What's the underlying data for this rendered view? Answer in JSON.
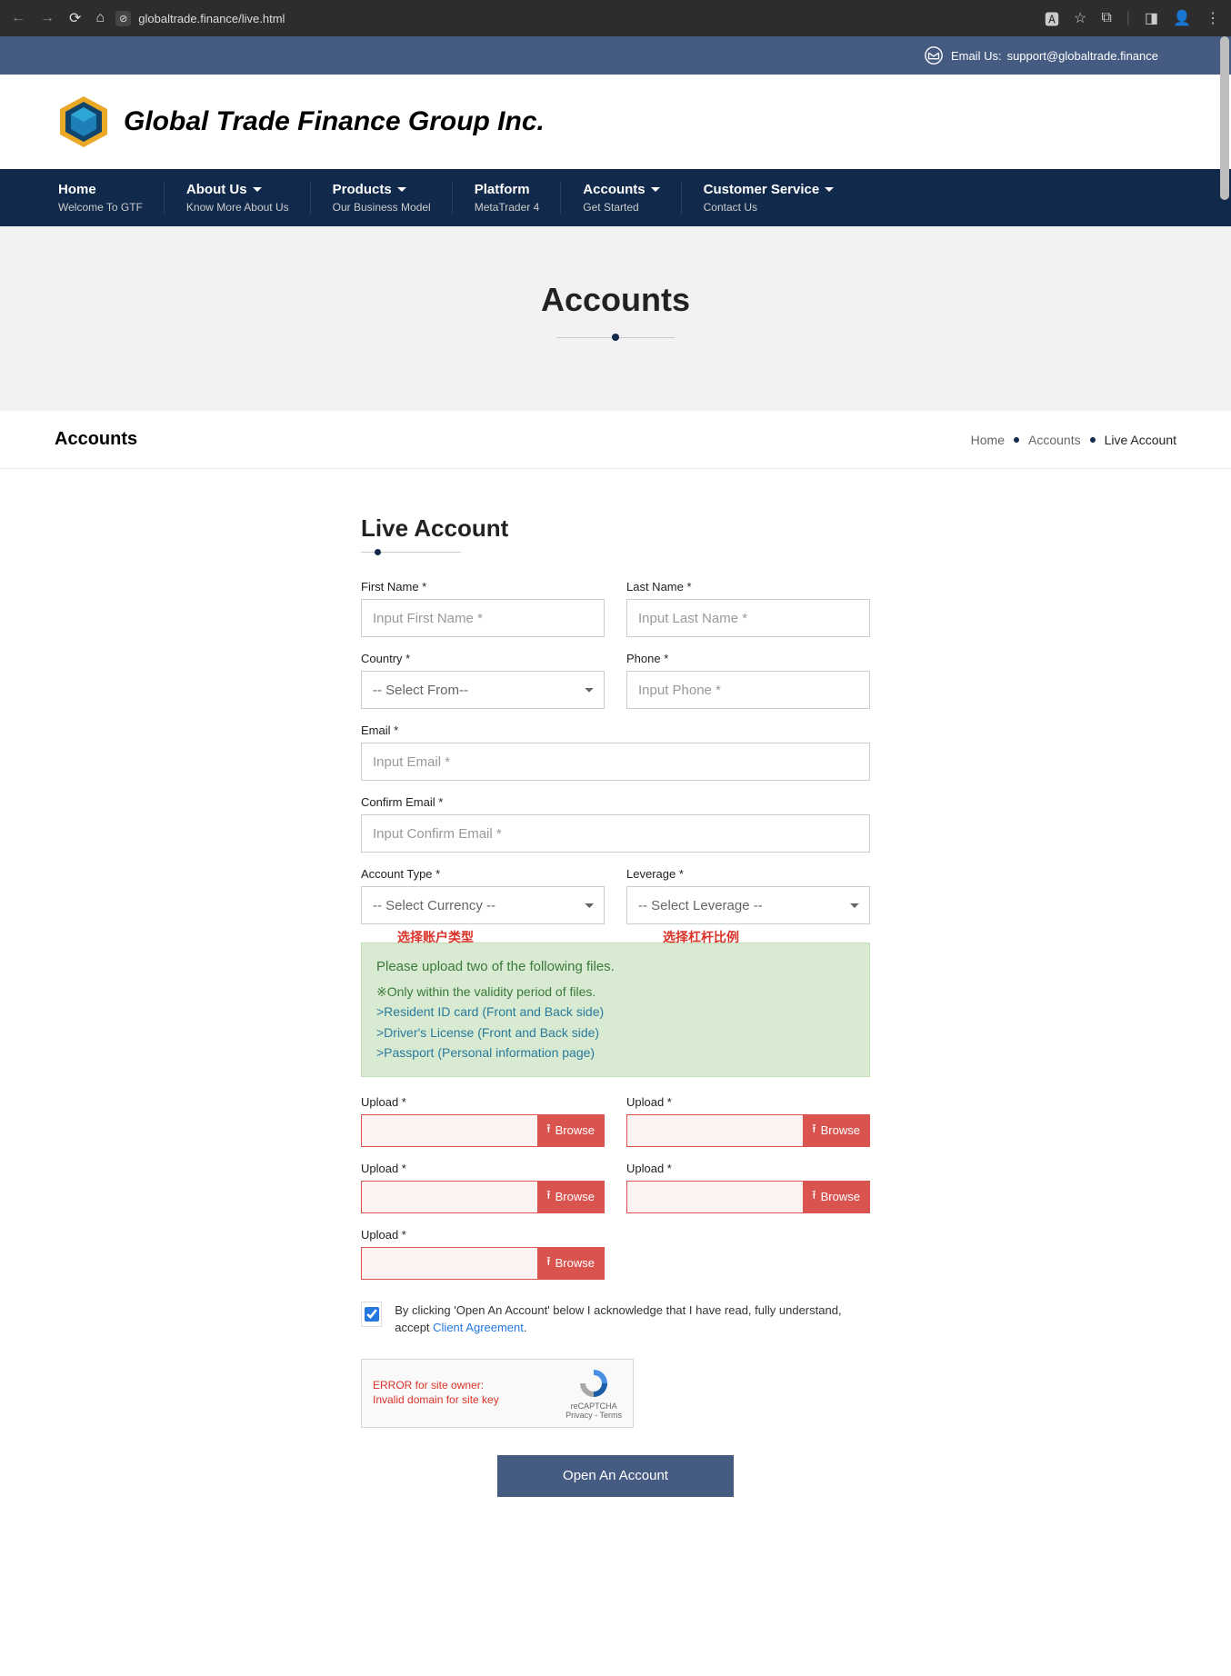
{
  "browser": {
    "url": "globaltrade.finance/live.html"
  },
  "topbar": {
    "email_label": "Email Us:",
    "email_value": "support@globaltrade.finance"
  },
  "header": {
    "company_name": "Global Trade Finance Group Inc."
  },
  "nav": [
    {
      "title": "Home",
      "sub": "Welcome To GTF",
      "dropdown": false
    },
    {
      "title": "About Us",
      "sub": "Know More About Us",
      "dropdown": true
    },
    {
      "title": "Products",
      "sub": "Our Business Model",
      "dropdown": true
    },
    {
      "title": "Platform",
      "sub": "MetaTrader 4",
      "dropdown": false
    },
    {
      "title": "Accounts",
      "sub": "Get Started",
      "dropdown": true
    },
    {
      "title": "Customer Service",
      "sub": "Contact Us",
      "dropdown": true
    }
  ],
  "page_title": "Accounts",
  "breadcrumb": {
    "section": "Accounts",
    "crumbs": [
      "Home",
      "Accounts",
      "Live Account"
    ]
  },
  "form": {
    "heading": "Live Account",
    "fields": {
      "first_name_label": "First Name *",
      "first_name_placeholder": "Input First Name *",
      "last_name_label": "Last Name *",
      "last_name_placeholder": "Input Last Name *",
      "country_label": "Country *",
      "country_selected": "-- Select From--",
      "phone_label": "Phone *",
      "phone_placeholder": "Input Phone *",
      "email_label": "Email *",
      "email_placeholder": "Input Email *",
      "confirm_email_label": "Confirm Email *",
      "confirm_email_placeholder": "Input Confirm Email *",
      "account_type_label": "Account Type *",
      "account_type_selected": "-- Select Currency --",
      "account_type_note": "选择账户类型",
      "leverage_label": "Leverage *",
      "leverage_selected": "-- Select Leverage --",
      "leverage_note": "选择杠杆比例"
    },
    "upload_notice": {
      "line1": "Please upload two of the following files.",
      "line2": "※Only within the validity period of files.",
      "doc1": ">Resident ID card (Front and Back side)",
      "doc2": ">Driver's License (Front and Back side)",
      "doc3": ">Passport (Personal information page)"
    },
    "upload_label": "Upload *",
    "browse_label": "Browse",
    "agreement": {
      "text_prefix": "By clicking 'Open An Account' below I acknowledge that I have read, fully understand, accept ",
      "link_text": "Client Agreement",
      "suffix": "."
    },
    "recaptcha": {
      "error_line1": "ERROR for site owner:",
      "error_line2": "Invalid domain for site key",
      "badge_title": "reCAPTCHA",
      "badge_sub": "Privacy - Terms"
    },
    "submit_label": "Open An Account"
  }
}
